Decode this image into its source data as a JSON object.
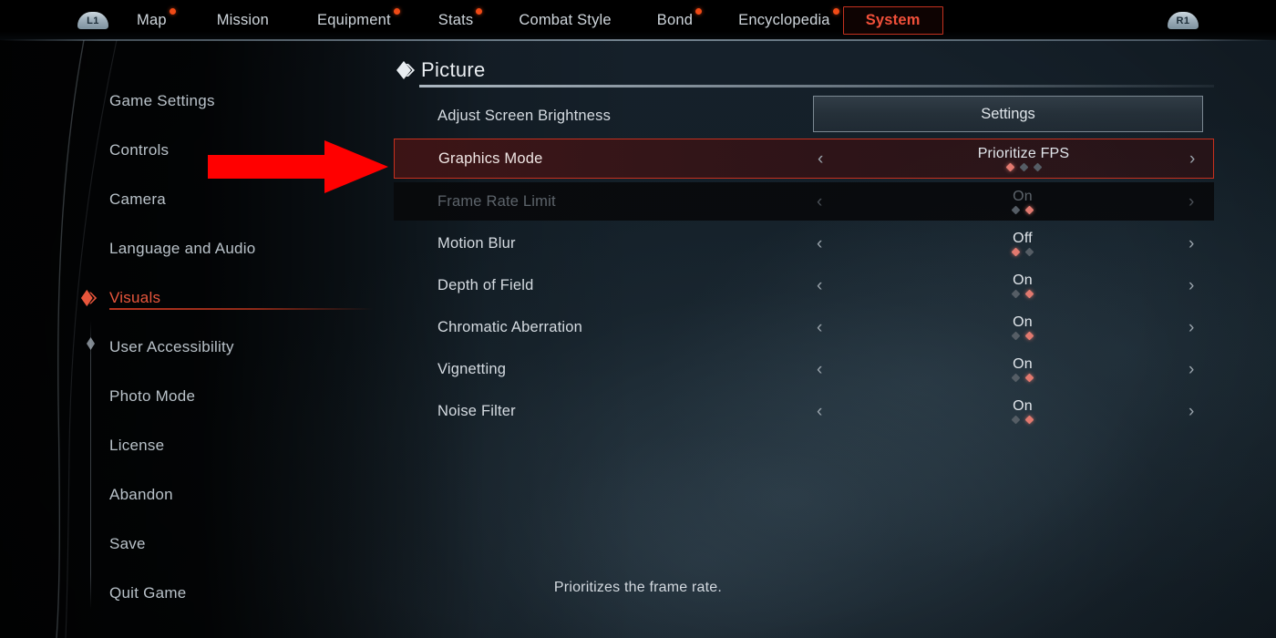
{
  "topbar": {
    "left_shoulder": "L1",
    "right_shoulder": "R1",
    "selected_tab": "System",
    "accent_dot_color": "#f04a16",
    "selected_border_color": "#c4311f",
    "tabs": [
      {
        "label": "Map",
        "has_dot": true,
        "selected": false
      },
      {
        "label": "Mission",
        "has_dot": false,
        "selected": false
      },
      {
        "label": "Equipment",
        "has_dot": true,
        "selected": false
      },
      {
        "label": "Stats",
        "has_dot": true,
        "selected": false
      },
      {
        "label": "Combat Style",
        "has_dot": false,
        "selected": false
      },
      {
        "label": "Bond",
        "has_dot": true,
        "selected": false
      },
      {
        "label": "Encyclopedia",
        "has_dot": true,
        "selected": false
      },
      {
        "label": "System",
        "has_dot": false,
        "selected": true
      }
    ]
  },
  "sidebar": {
    "active_item": "Visuals",
    "active_color": "#e8563c",
    "items": [
      {
        "label": "Game Settings",
        "active": false
      },
      {
        "label": "Controls",
        "active": false
      },
      {
        "label": "Camera",
        "active": false
      },
      {
        "label": "Language and Audio",
        "active": false
      },
      {
        "label": "Visuals",
        "active": true
      },
      {
        "label": "User Accessibility",
        "active": false
      },
      {
        "label": "Photo Mode",
        "active": false
      },
      {
        "label": "License",
        "active": false
      },
      {
        "label": "Abandon",
        "active": false
      },
      {
        "label": "Save",
        "active": false
      },
      {
        "label": "Quit Game",
        "active": false
      }
    ]
  },
  "panel": {
    "section_title": "Picture",
    "highlight_color": "#c8301e",
    "rows": [
      {
        "label": "Adjust Screen Brightness",
        "type": "button",
        "button_label": "Settings",
        "value": "",
        "dots_total": 0,
        "dots_active": -1,
        "disabled": false,
        "highlighted": false
      },
      {
        "label": "Graphics Mode",
        "type": "stepper",
        "value": "Prioritize FPS",
        "dots_total": 3,
        "dots_active": 0,
        "disabled": false,
        "highlighted": true
      },
      {
        "label": "Frame Rate Limit",
        "type": "stepper",
        "value": "On",
        "dots_total": 2,
        "dots_active": 1,
        "disabled": true,
        "highlighted": false
      },
      {
        "label": "Motion Blur",
        "type": "stepper",
        "value": "Off",
        "dots_total": 2,
        "dots_active": 0,
        "disabled": false,
        "highlighted": false
      },
      {
        "label": "Depth of Field",
        "type": "stepper",
        "value": "On",
        "dots_total": 2,
        "dots_active": 1,
        "disabled": false,
        "highlighted": false
      },
      {
        "label": "Chromatic Aberration",
        "type": "stepper",
        "value": "On",
        "dots_total": 2,
        "dots_active": 1,
        "disabled": false,
        "highlighted": false
      },
      {
        "label": "Vignetting",
        "type": "stepper",
        "value": "On",
        "dots_total": 2,
        "dots_active": 1,
        "disabled": false,
        "highlighted": false
      },
      {
        "label": "Noise Filter",
        "type": "stepper",
        "value": "On",
        "dots_total": 2,
        "dots_active": 1,
        "disabled": false,
        "highlighted": false
      }
    ],
    "chev_left": "‹",
    "chev_right": "›"
  },
  "description": "Prioritizes the frame rate.",
  "annotation": {
    "arrow_color": "#ff0000",
    "points_to": "Graphics Mode"
  }
}
